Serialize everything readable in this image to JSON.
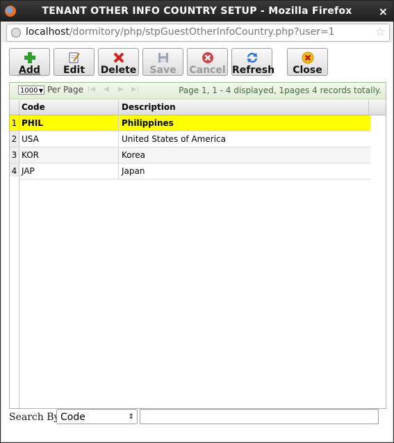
{
  "window": {
    "title": "TENANT OTHER INFO COUNTRY SETUP - Mozilla Firefox",
    "close_symbol": "×"
  },
  "address_bar": {
    "host": "localhost",
    "path": "/dormitory/php/stpGuestOtherInfoCountry.php?user=1"
  },
  "toolbar": {
    "add": {
      "label": "Add",
      "icon": "plus-icon"
    },
    "edit": {
      "label": "Edit",
      "icon": "edit-icon"
    },
    "delete": {
      "label": "Delete",
      "icon": "delete-icon"
    },
    "save": {
      "label": "Save",
      "icon": "save-icon"
    },
    "cancel": {
      "label": "Cancel",
      "icon": "cancel-icon"
    },
    "refresh": {
      "label": "Refresh",
      "icon": "refresh-icon"
    },
    "close": {
      "label": "Close",
      "icon": "close-icon"
    }
  },
  "pager": {
    "page_size": "1000",
    "per_page_label": "Per Page",
    "info": "Page 1, 1 - 4 displayed, 1pages 4 records totally."
  },
  "grid": {
    "columns": [
      "Code",
      "Description"
    ],
    "rows": [
      {
        "num": "1",
        "code": "PHIL",
        "description": "Philippines",
        "selected": true
      },
      {
        "num": "2",
        "code": "USA",
        "description": "United States of America",
        "selected": false
      },
      {
        "num": "3",
        "code": "KOR",
        "description": "Korea",
        "selected": false
      },
      {
        "num": "4",
        "code": "JAP",
        "description": "Japan",
        "selected": false
      }
    ]
  },
  "search": {
    "label": "Search By:",
    "field": "Code",
    "value": ""
  },
  "colors": {
    "selected_row": "#ffff00",
    "pager_text": "#3f6e3a"
  }
}
